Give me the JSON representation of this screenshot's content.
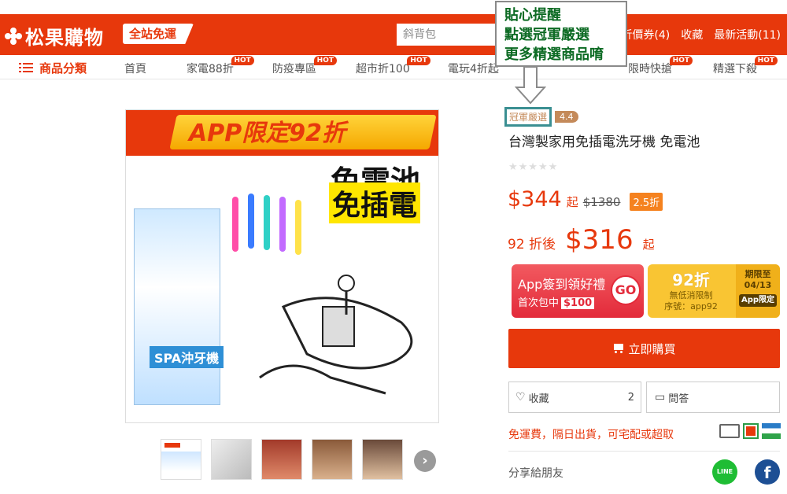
{
  "header": {
    "logo_text": "松果購物",
    "free_ship_label": "全站免運",
    "search_value": "斜背包",
    "links": [
      "折價券(4)",
      "收藏",
      "最新活動(11)"
    ]
  },
  "nav": {
    "category_label": "商品分類",
    "items": [
      {
        "label": "首頁",
        "hot": ""
      },
      {
        "label": "家電88折",
        "hot": "HOT"
      },
      {
        "label": "防疫專區",
        "hot": "HOT"
      },
      {
        "label": "超市折100",
        "hot": "HOT"
      },
      {
        "label": "電玩4折起",
        "hot": ""
      },
      {
        "label": "限時快搶",
        "hot": "HOT"
      },
      {
        "label": "精選下殺",
        "hot": "HOT"
      }
    ]
  },
  "callout": {
    "lines": [
      "貼心提醒",
      "點選冠軍嚴選",
      "更多精選商品唷"
    ]
  },
  "product_image": {
    "banner_text": "APP限定92折",
    "sub_text_1": "免電池",
    "sub_text_2": "免插電",
    "box_label": "SPA沖牙機"
  },
  "product": {
    "badge": "冠軍嚴選",
    "rating": "4.4",
    "title": "台灣製家用免插電洗牙機 免電池",
    "stars": "★★★★★",
    "price": "$344",
    "price_suffix": "起",
    "original_price": "$1380",
    "discount": "2.5折",
    "after_label": "92 折後",
    "after_price": "$316",
    "after_suffix": "起"
  },
  "promo_app": {
    "line1": "App簽到領好禮",
    "line2": "首次包中",
    "amount": "$100",
    "go": "GO"
  },
  "promo_coupon": {
    "big": "92折",
    "line1": "無低消限制",
    "line2": "序號：app92",
    "side_line1": "期限至",
    "side_line2": "04/13",
    "app_only": "App限定"
  },
  "actions": {
    "buy_label": "立即購買",
    "fav_label": "收藏",
    "fav_count": "2",
    "qa_label": "問答"
  },
  "shipping": {
    "text": "免運費，隔日出貨，可宅配或超取"
  },
  "share": {
    "label": "分享給朋友",
    "line": "LINE",
    "facebook": "f"
  },
  "colors": {
    "brand": "#e7380c",
    "callout_text": "#0d6b24",
    "badge_border": "#3a8f92"
  }
}
